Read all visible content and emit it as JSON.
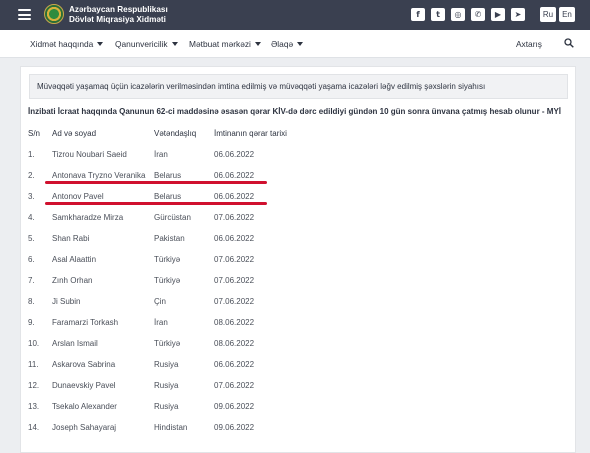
{
  "header": {
    "brand_line1": "Azərbaycan Respublikası",
    "brand_line2": "Dövlət Miqrasiya Xidməti",
    "social": [
      {
        "icon": "facebook-icon",
        "glyph": "f"
      },
      {
        "icon": "twitter-icon",
        "glyph": "t"
      },
      {
        "icon": "instagram-icon",
        "glyph": "◎"
      },
      {
        "icon": "whatsapp-icon",
        "glyph": "✆"
      },
      {
        "icon": "youtube-icon",
        "glyph": "▶"
      },
      {
        "icon": "telegram-icon",
        "glyph": "➤"
      }
    ],
    "languages": [
      "Ru",
      "En"
    ]
  },
  "nav": {
    "items": [
      "Xidmət haqqında",
      "Qanunvericilik",
      "Mətbuat mərkəzi",
      "Əlaqə"
    ],
    "search_label": "Axtarış"
  },
  "main": {
    "notice": "Müvəqqəti yaşamaq üçün icazələrin verilməsindən imtina edilmiş və müvəqqəti yaşama icazələri ləğv edilmiş şəxslərin siyahısı",
    "subtitle": "İnzibati İcraat haqqında Qanunun 62-ci maddəsinə əsasən qərar KİV-də dərc edildiyi gündən 10 gün sonra ünvana çatmış hesab olunur - MYİ",
    "columns": [
      "S/n",
      "Ad və soyad",
      "Vətəndaşlıq",
      "İmtinanın qərar tarixi"
    ],
    "rows": [
      {
        "n": "1.",
        "name": "Tizrou Noubari Saeid",
        "citizenship": "İran",
        "date": "06.06.2022"
      },
      {
        "n": "2.",
        "name": "Antonava Tryzno Veranika",
        "citizenship": "Belarus",
        "date": "06.06.2022"
      },
      {
        "n": "3.",
        "name": "Antonov Pavel",
        "citizenship": "Belarus",
        "date": "06.06.2022"
      },
      {
        "n": "4.",
        "name": "Samkharadze Mirza",
        "citizenship": "Gürcüstan",
        "date": "07.06.2022"
      },
      {
        "n": "5.",
        "name": "Shan Rabi",
        "citizenship": "Pakistan",
        "date": "06.06.2022"
      },
      {
        "n": "6.",
        "name": "Asal Alaattin",
        "citizenship": "Türkiyə",
        "date": "07.06.2022"
      },
      {
        "n": "7.",
        "name": "Zınh Orhan",
        "citizenship": "Türkiyə",
        "date": "07.06.2022"
      },
      {
        "n": "8.",
        "name": "Ji Subin",
        "citizenship": "Çin",
        "date": "07.06.2022"
      },
      {
        "n": "9.",
        "name": "Faramarzi Torkash",
        "citizenship": "İran",
        "date": "08.06.2022"
      },
      {
        "n": "10.",
        "name": "Arslan Ismail",
        "citizenship": "Türkiyə",
        "date": "08.06.2022"
      },
      {
        "n": "11.",
        "name": "Askarova Sabrina",
        "citizenship": "Rusiya",
        "date": "06.06.2022"
      },
      {
        "n": "12.",
        "name": "Dunaevskiy Pavel",
        "citizenship": "Rusiya",
        "date": "07.06.2022"
      },
      {
        "n": "13.",
        "name": "Tsekalo Alexander",
        "citizenship": "Rusiya",
        "date": "09.06.2022"
      },
      {
        "n": "14.",
        "name": "Joseph Sahayaraj",
        "citizenship": "Hindistan",
        "date": "09.06.2022"
      }
    ],
    "highlighted_rows": [
      2,
      3
    ],
    "highlight_color": "#d0102e"
  }
}
